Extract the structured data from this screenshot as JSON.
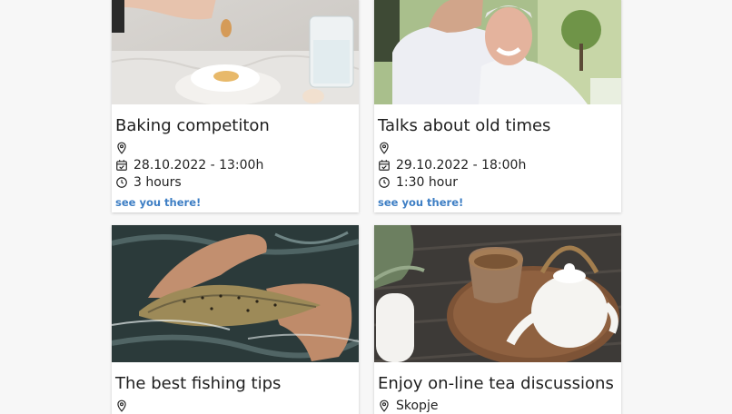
{
  "colors": {
    "page_background": "#f7f7f7",
    "card_background": "#ffffff",
    "link": "#3d7ec4",
    "text": "#1f1f1f"
  },
  "cards": [
    {
      "title": "Baking competiton",
      "location": "",
      "datetime": "28.10.2022 - 13:00h",
      "duration": "3 hours",
      "cta": "see you there!",
      "image": "photo-baking-eggs-flour"
    },
    {
      "title": "Talks about old times",
      "location": "",
      "datetime": "29.10.2022 - 18:00h",
      "duration": "1:30 hour",
      "cta": "see you there!",
      "image": "photo-elderly-men-talking"
    },
    {
      "title": "The best fishing tips",
      "location": "",
      "image": "photo-trout-in-hands"
    },
    {
      "title": "Enjoy on-line tea discussions",
      "location": "Skopje",
      "image": "photo-teapot-and-cup"
    }
  ],
  "icons": {
    "location": "map-pin-icon",
    "date": "calendar-icon",
    "duration": "clock-icon"
  }
}
